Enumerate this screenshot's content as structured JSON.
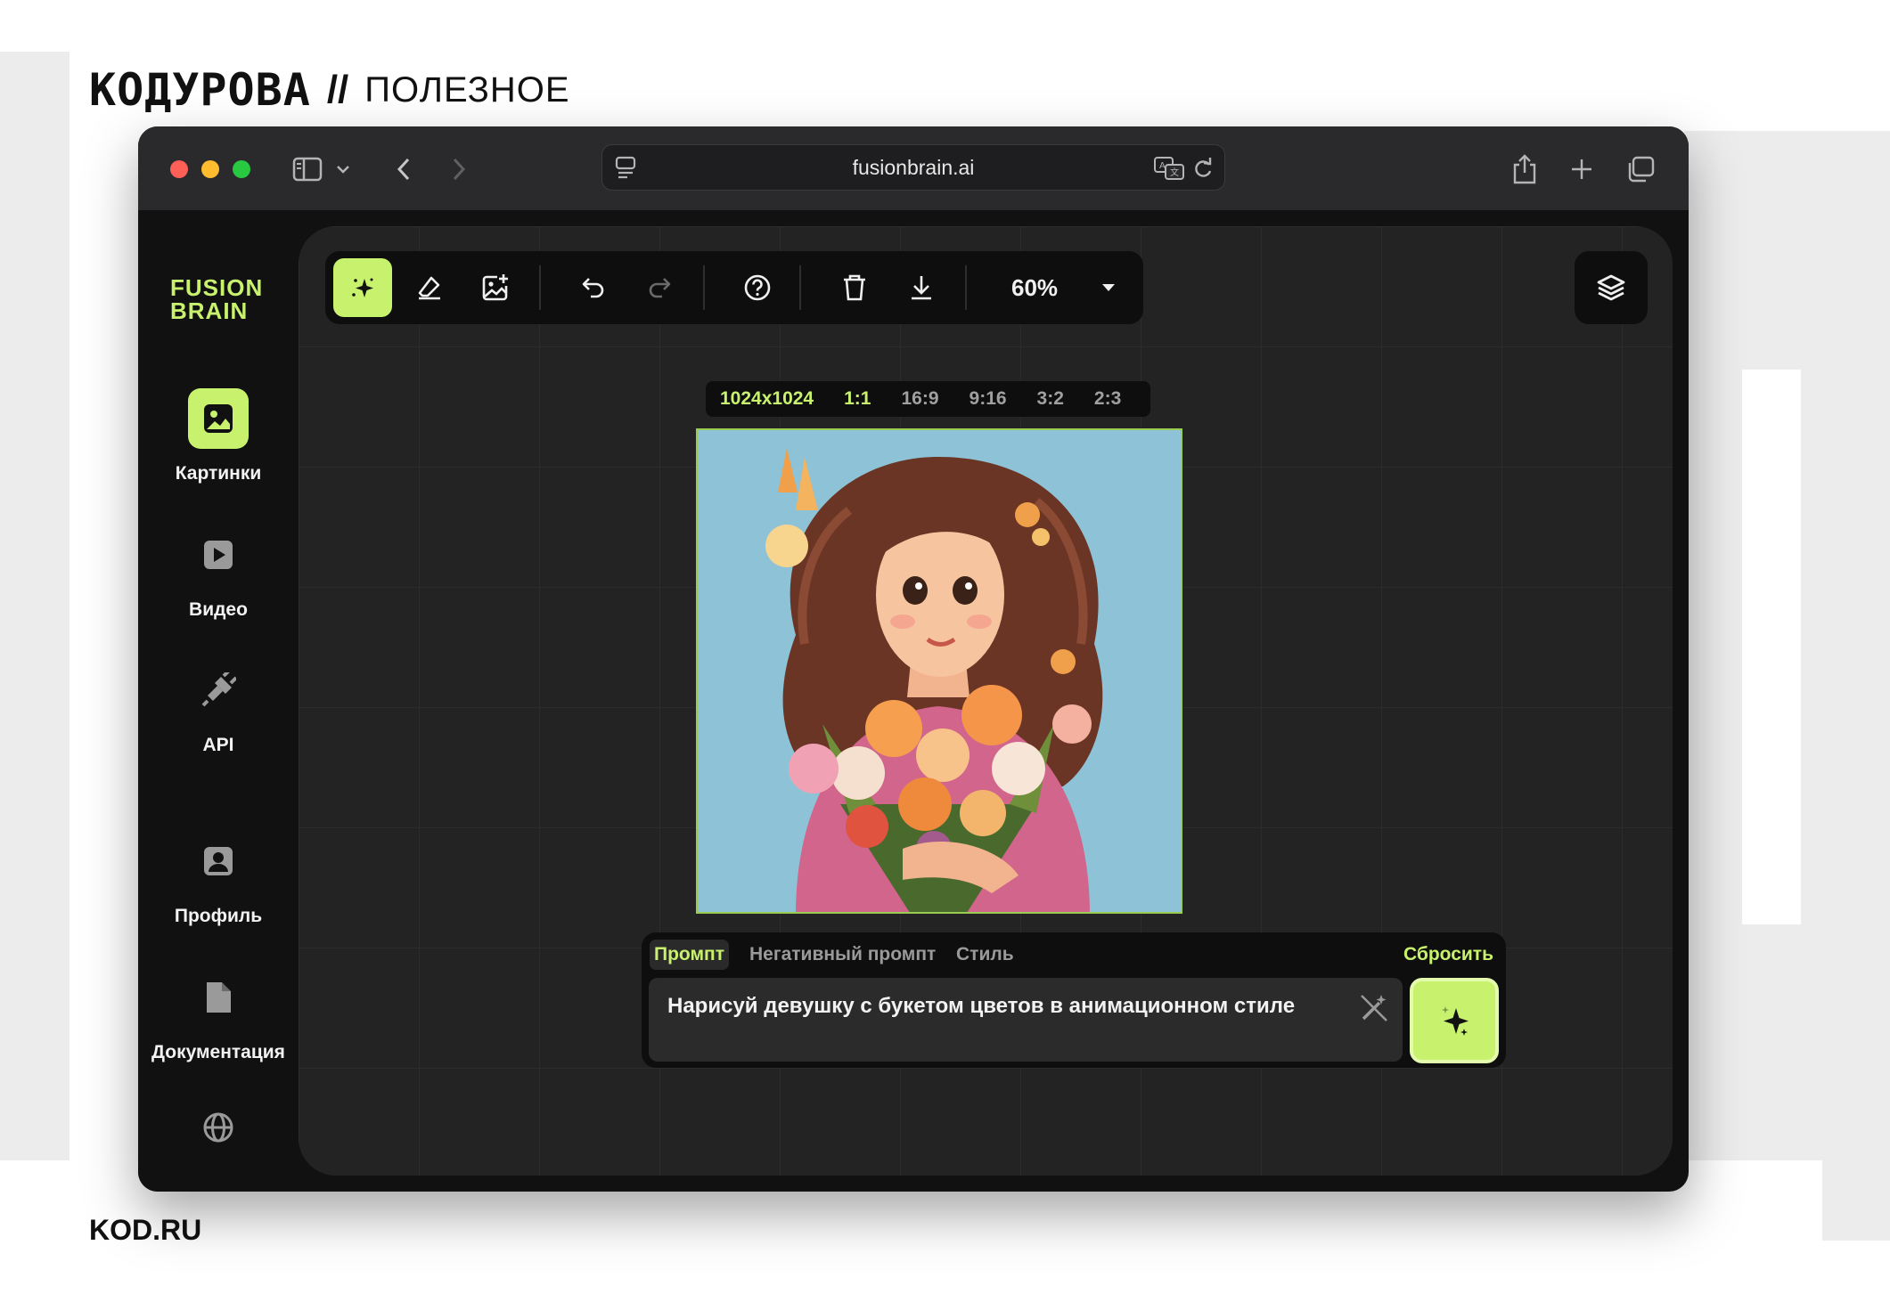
{
  "page": {
    "brand_logo": "КОДУРОВА",
    "brand_separator": "//",
    "brand_section": "ПОЛЕЗНОЕ",
    "footer": "KOD.RU"
  },
  "browser": {
    "url": "fusionbrain.ai",
    "icons": [
      "sidebar-toggle-icon",
      "chevron-down-icon",
      "back-icon",
      "forward-icon",
      "reader-icon",
      "translate-icon",
      "reload-icon",
      "share-icon",
      "new-tab-icon",
      "tabs-overview-icon"
    ]
  },
  "app": {
    "logo_line1": "FUSION",
    "logo_line2": "BRAIN",
    "accent": "#c8f26d",
    "nav": [
      {
        "label": "Картинки",
        "icon": "image-icon",
        "active": true
      },
      {
        "label": "Видео",
        "icon": "play-icon",
        "active": false
      },
      {
        "label": "API",
        "icon": "plug-icon",
        "active": false
      },
      {
        "label": "Профиль",
        "icon": "profile-icon",
        "active": false
      },
      {
        "label": "Документация",
        "icon": "document-icon",
        "active": false
      }
    ],
    "language_icon": "globe-icon"
  },
  "toolbar": {
    "tools": [
      "magic-generate-icon",
      "eraser-icon",
      "add-image-icon",
      "undo-icon",
      "redo-icon",
      "help-icon",
      "trash-icon",
      "download-icon"
    ],
    "zoom": "60%",
    "layers_icon": "layers-icon"
  },
  "canvas": {
    "size": "1024x1024",
    "ratios": [
      "1:1",
      "16:9",
      "9:16",
      "3:2",
      "2:3"
    ],
    "selected_ratio": "1:1"
  },
  "prompt": {
    "tabs": [
      "Промпт",
      "Негативный промпт",
      "Стиль"
    ],
    "active_tab": "Промпт",
    "reset_label": "Сбросить",
    "text": "Нарисуй девушку с букетом цветов в анимационном стиле",
    "generate_icon": "sparkle-icon"
  }
}
